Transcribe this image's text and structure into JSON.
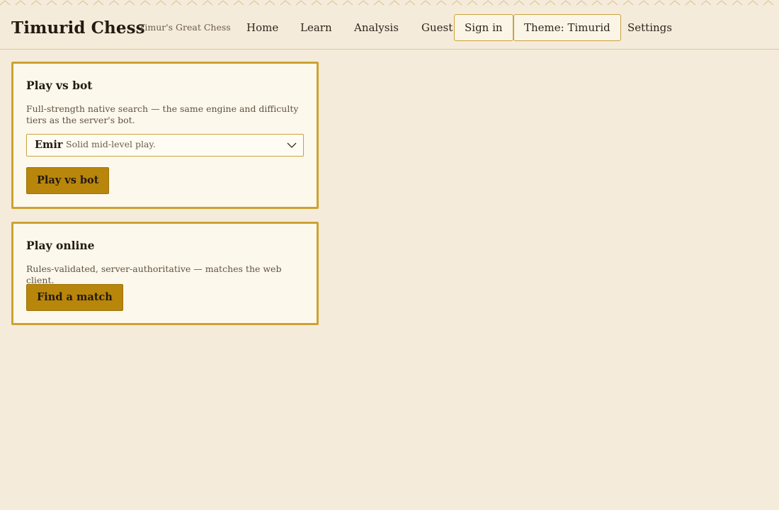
{
  "header": {
    "brand": "Timurid Chess",
    "tagline": "Timur's Great Chess",
    "nav": [
      "Home",
      "Learn",
      "Analysis"
    ],
    "guest": "Guest",
    "sign_in": "Sign in",
    "theme": "Theme: Timurid",
    "settings": "Settings"
  },
  "bot_card": {
    "title": "Play vs bot",
    "description": "Full-strength native search — the same engine and difficulty tiers as the server's bot.",
    "difficulty": {
      "name": "Emir",
      "description": "Solid mid-level play."
    },
    "button": "Play vs bot"
  },
  "online_card": {
    "title": "Play online",
    "description": "Rules-validated, server-authoritative — matches the web client.",
    "button": "Find a match"
  },
  "colors": {
    "background": "#f5ebdb",
    "card_border": "#cda232",
    "primary_button": "#b8860b"
  }
}
